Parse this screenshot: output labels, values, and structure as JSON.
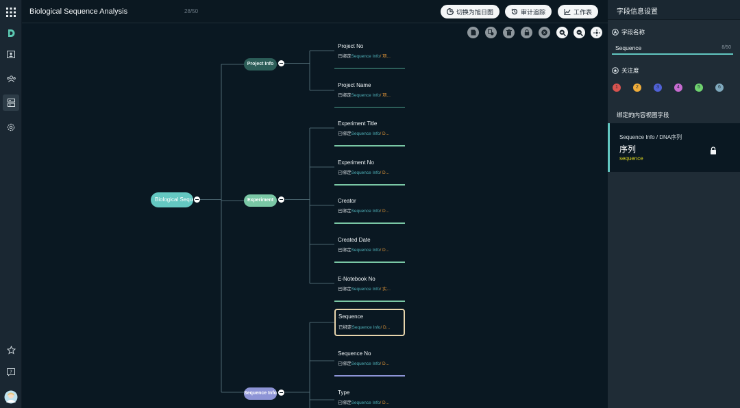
{
  "header": {
    "title": "Biological Sequence Analysis",
    "count": "28/50",
    "btn_switch": "切换为旭日图",
    "btn_audit": "审计追踪",
    "btn_sheet": "工作表"
  },
  "rail": {
    "items": [
      "apps-grid-icon",
      "logo-icon",
      "book-icon",
      "people-icon",
      "database-icon",
      "settings-icon",
      "star-icon",
      "help-icon",
      "avatar"
    ]
  },
  "toolbar": {
    "tools": [
      "note-icon",
      "import-icon",
      "delete-icon",
      "lock-icon",
      "close-icon",
      "zoom-in-icon",
      "zoom-out-icon",
      "fit-icon"
    ]
  },
  "map": {
    "root": "Biological Sequence",
    "categories": [
      "Project Info",
      "Experiment",
      "Sequence Info"
    ],
    "bound_prefix": "已绑定",
    "leaves": [
      {
        "name": "Project No",
        "info": "Sequence Info",
        "tail": "/ 项..."
      },
      {
        "name": "Project Name",
        "info": "Sequence Info",
        "tail": "/ 项..."
      },
      {
        "name": "Experiment Title",
        "info": "Sequence Info",
        "tail": "/ D..."
      },
      {
        "name": "Experiment No",
        "info": "Sequence Info",
        "tail": "/ D..."
      },
      {
        "name": "Creator",
        "info": "Sequence Info",
        "tail": "/ D..."
      },
      {
        "name": "Created Date",
        "info": "Sequence Info",
        "tail": "/ D..."
      },
      {
        "name": "E-Notebook No",
        "info": "Sequence Info",
        "tail": "/ 实..."
      },
      {
        "name": "Sequence",
        "info": "Sequence Info",
        "tail": "/ D..."
      },
      {
        "name": "Sequence No",
        "info": "Sequence Info",
        "tail": "/ D..."
      },
      {
        "name": "Type",
        "info": "Sequence Info",
        "tail": "/ D..."
      }
    ]
  },
  "panel": {
    "title": "字段信息设置",
    "field_name_label": "字段名称",
    "field_value": "Sequence",
    "field_count": "8/50",
    "attention_label": "关注度",
    "levels": [
      "1",
      "2",
      "3",
      "4",
      "5",
      "6"
    ],
    "bound_title": "绑定的内容视图字段",
    "bound_path": "Sequence Info / DNA序列",
    "bound_name": "序列",
    "bound_key": "sequence"
  },
  "colors": {
    "accent": "#63c8c2",
    "level_colors": [
      "#d9534f",
      "#f0ad3a",
      "#5061d6",
      "#c76bd1",
      "#6fd36f",
      "#7fa9bd"
    ]
  }
}
